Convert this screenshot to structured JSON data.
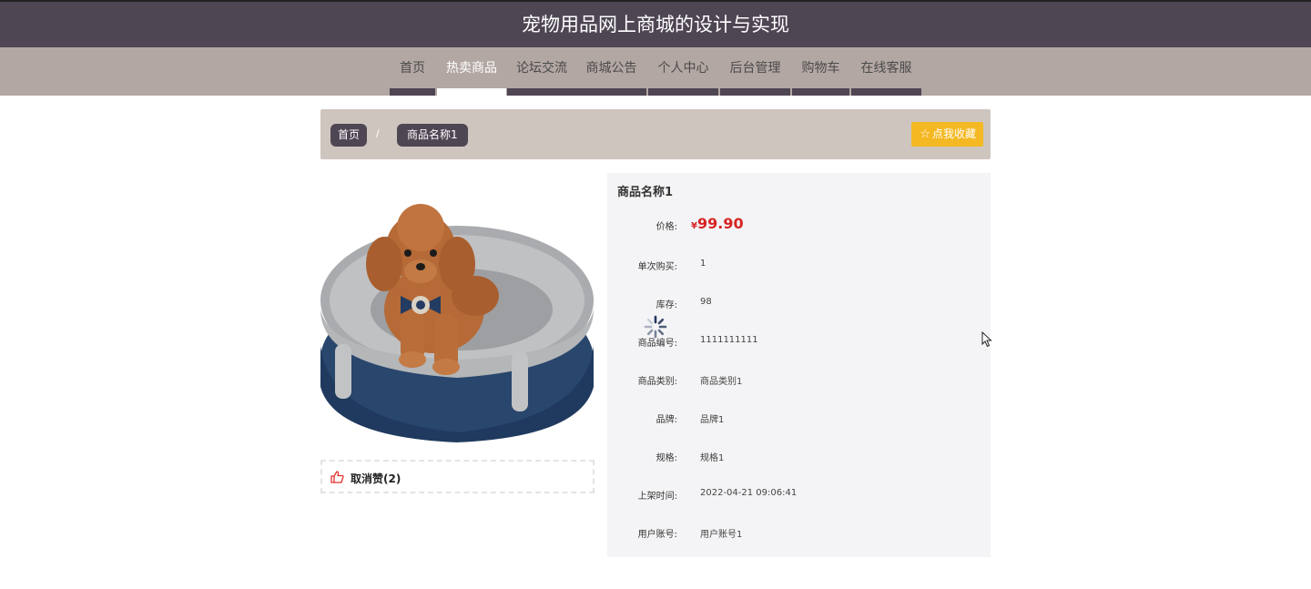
{
  "header": {
    "title": "宠物用品网上商城的设计与实现"
  },
  "nav": {
    "items": [
      {
        "label": "首页",
        "active": false
      },
      {
        "label": "热卖商品",
        "active": true
      },
      {
        "label": "论坛交流",
        "active": false
      },
      {
        "label": "商城公告",
        "active": false
      },
      {
        "label": "个人中心",
        "active": false
      },
      {
        "label": "后台管理",
        "active": false
      },
      {
        "label": "购物车",
        "active": false
      },
      {
        "label": "在线客服",
        "active": false
      }
    ]
  },
  "breadcrumb": {
    "home": "首页",
    "separator": "/",
    "current": "商品名称1"
  },
  "favorite": {
    "label": "点我收藏",
    "icon": "star-outline-icon"
  },
  "like": {
    "label": "取消赞(2)",
    "icon": "thumbs-up-icon"
  },
  "product": {
    "name": "商品名称1",
    "price_label": "价格:",
    "currency": "¥",
    "price": "99.90",
    "fields": [
      {
        "label": "单次购买:",
        "value": "1"
      },
      {
        "label": "库存:",
        "value": "98"
      },
      {
        "label": "商品编号:",
        "value": "1111111111"
      },
      {
        "label": "商品类别:",
        "value": "商品类别1"
      },
      {
        "label": "品牌:",
        "value": "品牌1"
      },
      {
        "label": "规格:",
        "value": "规格1"
      },
      {
        "label": "上架时间:",
        "value": "2022-04-21 09:06:41"
      },
      {
        "label": "用户账号:",
        "value": "用户账号1"
      }
    ]
  },
  "colors": {
    "header_bg": "#4f4654",
    "nav_bg": "#b3a7a3",
    "breadcrumb_bg": "#cec5be",
    "favorite_bg": "#f4b823",
    "price": "#d62323",
    "details_bg": "#f4f4f6"
  }
}
